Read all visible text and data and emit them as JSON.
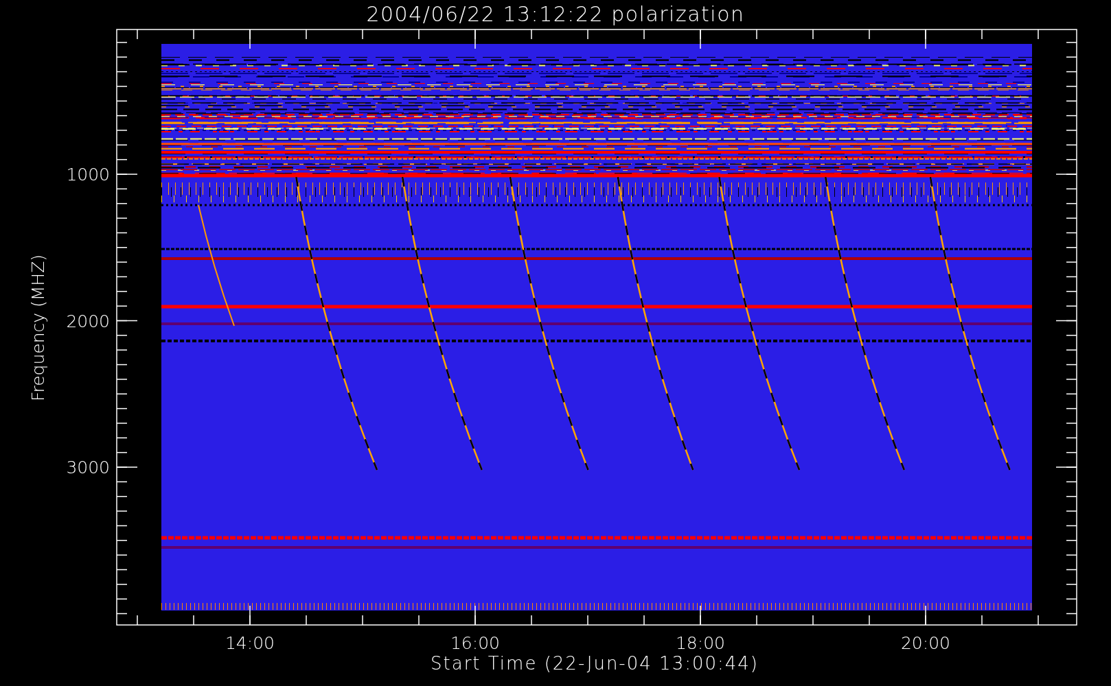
{
  "plot": {
    "title": "2004/06/22 13:12:22 polarization",
    "ylabel": "Frequency (MHZ)",
    "xlabel": "Start Time (22-Jun-04 13:00:44)",
    "yticks": [
      "1000",
      "2000",
      "3000"
    ],
    "xticks": [
      "14:00",
      "16:00",
      "18:00",
      "20:00"
    ]
  }
}
